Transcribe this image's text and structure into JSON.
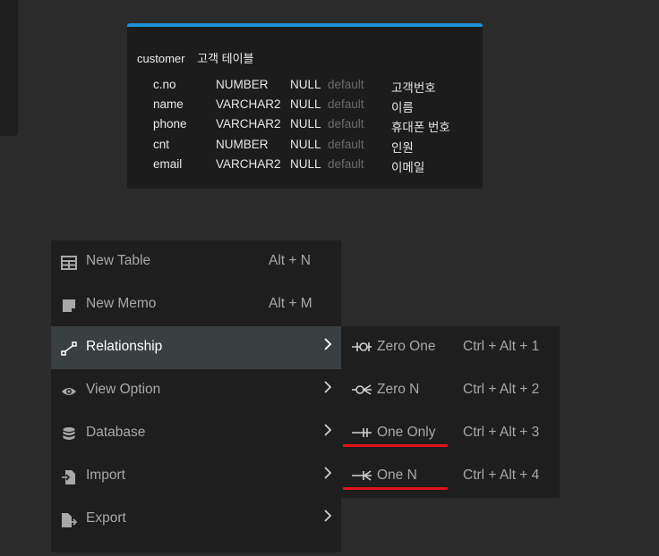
{
  "table": {
    "name": "customer",
    "comment": "고객 테이블",
    "columns": [
      {
        "name": "c.no",
        "type": "NUMBER",
        "nullable": "NULL",
        "default": "default",
        "comment": "고객번호"
      },
      {
        "name": "name",
        "type": "VARCHAR2",
        "nullable": "NULL",
        "default": "default",
        "comment": "이름"
      },
      {
        "name": "phone",
        "type": "VARCHAR2",
        "nullable": "NULL",
        "default": "default",
        "comment": "휴대폰 번호"
      },
      {
        "name": "cnt",
        "type": "NUMBER",
        "nullable": "NULL",
        "default": "default",
        "comment": "인원"
      },
      {
        "name": "email",
        "type": "VARCHAR2",
        "nullable": "NULL",
        "default": "default",
        "comment": "이메일"
      }
    ]
  },
  "context_menu": {
    "items": [
      {
        "label": "New Table",
        "shortcut": "Alt + N",
        "icon": "table-icon"
      },
      {
        "label": "New Memo",
        "shortcut": "Alt + M",
        "icon": "memo-icon"
      },
      {
        "label": "Relationship",
        "shortcut": "",
        "icon": "relationship-icon",
        "active": true
      },
      {
        "label": "View Option",
        "shortcut": "",
        "icon": "eye-icon"
      },
      {
        "label": "Database",
        "shortcut": "",
        "icon": "database-icon"
      },
      {
        "label": "Import",
        "shortcut": "",
        "icon": "import-icon"
      },
      {
        "label": "Export",
        "shortcut": "",
        "icon": "export-icon"
      }
    ]
  },
  "relationship_submenu": {
    "items": [
      {
        "label": "Zero One",
        "shortcut": "Ctrl + Alt + 1",
        "icon": "zero-one-icon"
      },
      {
        "label": "Zero N",
        "shortcut": "Ctrl + Alt + 2",
        "icon": "zero-n-icon"
      },
      {
        "label": "One Only",
        "shortcut": "Ctrl + Alt + 3",
        "icon": "one-only-icon",
        "highlighted": true
      },
      {
        "label": "One N",
        "shortcut": "Ctrl + Alt + 4",
        "icon": "one-n-icon",
        "highlighted": true
      }
    ]
  },
  "colors": {
    "accent": "#1e90d6",
    "highlight_underline": "#e0141a",
    "active_bg": "#3a3f42"
  }
}
